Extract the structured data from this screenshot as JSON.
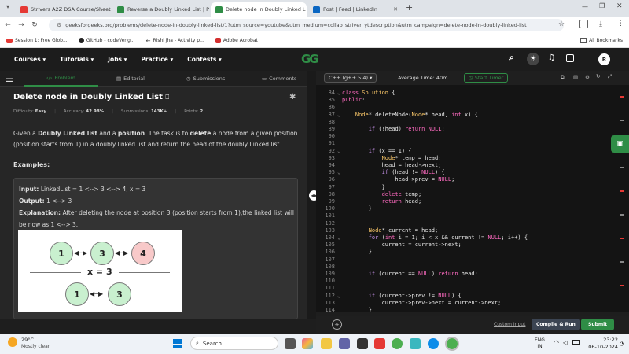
{
  "browser": {
    "tabs": [
      {
        "title": "Strivers A2Z DSA Course/Sheet",
        "color": "#e53935"
      },
      {
        "title": "Reverse a Doubly Linked List | P",
        "color": "#2f8d46"
      },
      {
        "title": "Delete node in Doubly Linked L",
        "color": "#2f8d46"
      },
      {
        "title": "Post | Feed | LinkedIn",
        "color": "#0a66c2"
      }
    ],
    "url": "geeksforgeeks.org/problems/delete-node-in-doubly-linked-list/1?utm_source=youtube&utm_medium=collab_striver_ytdescription&utm_campaign=delete-node-in-doubly-linked-list",
    "bookmarks": [
      "Session 1: Free Glob...",
      "GitHub - codeVeng...",
      "Rishi jha - Activity p...",
      "Adobe Acrobat"
    ],
    "all_bookmarks": "All Bookmarks"
  },
  "nav": {
    "items": [
      "Courses",
      "Tutorials",
      "Jobs",
      "Practice",
      "Contests"
    ],
    "logo": "GG",
    "avatar": "R"
  },
  "problem_tabs": [
    "Problem",
    "Editorial",
    "Submissions",
    "Comments"
  ],
  "problem": {
    "title": "Delete node in Doubly Linked List",
    "difficulty_label": "Difficulty:",
    "difficulty": "Easy",
    "accuracy_label": "Accuracy:",
    "accuracy": "42.98%",
    "submissions_label": "Submissions:",
    "submissions": "143K+",
    "points_label": "Points:",
    "points": "2",
    "desc_1": "Given a ",
    "desc_b1": "Doubly Linked list",
    "desc_2": " and a ",
    "desc_b2": "position",
    "desc_3": ". The task is to ",
    "desc_b3": "delete",
    "desc_4": " a node from a given position (position starts from 1) in a doubly linked list and return the head of the doubly Linked list.",
    "examples_heading": "Examples:",
    "input_label": "Input:",
    "input": " LinkedList = 1 <--> 3 <--> 4, x = 3",
    "output_label": "Output:",
    "output": " 1 <--> 3",
    "explanation_label": "Explanation:",
    "explanation": " After deleting the node at position 3 (position starts from 1),the linked list will be now as 1 <--> 3."
  },
  "diagram": {
    "top_nodes": [
      "1",
      "3",
      "4"
    ],
    "equation": "x = 3",
    "bottom_nodes": [
      "1",
      "3"
    ]
  },
  "editor": {
    "language": "C++ (g++ 5.4)",
    "average_time": "Average Time: 40m",
    "timer": "Start Timer",
    "custom_input": "Custom Input",
    "compile": "Compile & Run",
    "submit": "Submit",
    "lines": [
      {
        "n": "84",
        "code": "class Solution {"
      },
      {
        "n": "85",
        "code": "public:"
      },
      {
        "n": "86",
        "code": ""
      },
      {
        "n": "87",
        "code": "    Node* deleteNode(Node* head, int x) {"
      },
      {
        "n": "88",
        "code": ""
      },
      {
        "n": "89",
        "code": "        if (!head) return NULL;"
      },
      {
        "n": "90",
        "code": ""
      },
      {
        "n": "91",
        "code": ""
      },
      {
        "n": "92",
        "code": "        if (x == 1) {"
      },
      {
        "n": "93",
        "code": "            Node* temp = head;"
      },
      {
        "n": "94",
        "code": "            head = head->next;"
      },
      {
        "n": "95",
        "code": "            if (head != NULL) {"
      },
      {
        "n": "96",
        "code": "                head->prev = NULL;"
      },
      {
        "n": "97",
        "code": "            }"
      },
      {
        "n": "98",
        "code": "            delete temp;"
      },
      {
        "n": "99",
        "code": "            return head;"
      },
      {
        "n": "100",
        "code": "        }"
      },
      {
        "n": "101",
        "code": ""
      },
      {
        "n": "102",
        "code": ""
      },
      {
        "n": "103",
        "code": "        Node* current = head;"
      },
      {
        "n": "104",
        "code": "        for (int i = 1; i < x && current != NULL; i++) {"
      },
      {
        "n": "105",
        "code": "            current = current->next;"
      },
      {
        "n": "106",
        "code": "        }"
      },
      {
        "n": "107",
        "code": ""
      },
      {
        "n": "108",
        "code": ""
      },
      {
        "n": "109",
        "code": "        if (current == NULL) return head;"
      },
      {
        "n": "110",
        "code": ""
      },
      {
        "n": "111",
        "code": ""
      },
      {
        "n": "112",
        "code": "        if (current->prev != NULL) {"
      },
      {
        "n": "113",
        "code": "            current->prev->next = current->next;"
      },
      {
        "n": "114",
        "code": "        }"
      }
    ]
  },
  "taskbar": {
    "weather_temp": "29°C",
    "weather_desc": "Mostly clear",
    "search": "Search",
    "lang1": "ENG",
    "lang2": "IN",
    "time": "23:22",
    "date": "06-10-2024"
  },
  "colors": {
    "gfg_green": "#2f8d46",
    "keyword": "#ff6ac1",
    "control": "#c792ea"
  }
}
